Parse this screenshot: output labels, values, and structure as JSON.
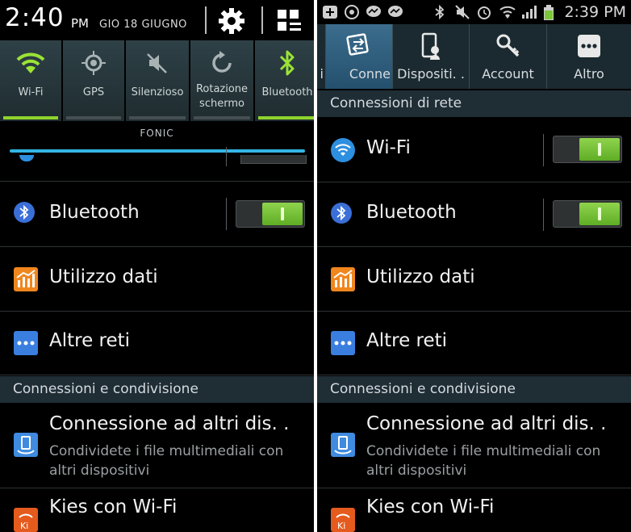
{
  "shade": {
    "time": "2:40",
    "ampm": "PM",
    "date": "GIO 18 GIUGNO",
    "settings_icon": "gear-icon",
    "quick_panel_icon": "grid-icon",
    "tiles": [
      {
        "label": "Wi-Fi",
        "icon": "wifi-icon",
        "active": true
      },
      {
        "label": "GPS",
        "icon": "gps-icon",
        "active": false
      },
      {
        "label": "Silenzioso",
        "icon": "mute-icon",
        "active": false
      },
      {
        "label": "Rotazione schermo",
        "icon": "rotate-icon",
        "active": false
      },
      {
        "label": "Bluetooth",
        "icon": "bluetooth-icon",
        "active": true
      }
    ],
    "carrier": "FONIC"
  },
  "status": {
    "time": "2:39 PM"
  },
  "tabs": [
    {
      "label": "i"
    },
    {
      "label": "Conne",
      "active": true
    },
    {
      "label": "Dispositi. .",
      "active": false
    },
    {
      "label": "Account",
      "active": false
    },
    {
      "label": "Altro",
      "active": false
    }
  ],
  "sections": {
    "network": "Connessioni di rete",
    "sharing": "Connessioni e condivisione"
  },
  "items": {
    "wifi": {
      "title": "Wi-Fi",
      "toggle": true
    },
    "bluetooth": {
      "title": "Bluetooth",
      "toggle": true
    },
    "data_usage": {
      "title": "Utilizzo dati"
    },
    "other_networks": {
      "title": "Altre reti"
    },
    "connect_devices": {
      "title": "Connessione ad altri dis. .",
      "subtitle": "Condividete i file multimediali con altri dispositivi"
    },
    "kies": {
      "title": "Kies con Wi-Fi"
    }
  },
  "colors": {
    "accent_blue": "#33b5e5",
    "toggle_green": "#6cc030",
    "tab_active": "#2f5f7f"
  }
}
